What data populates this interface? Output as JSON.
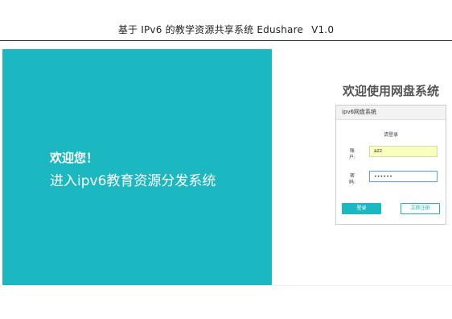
{
  "doc_header": {
    "title": "基于 IPv6 的教学资源共享系统  Edushare",
    "version": "V1.0"
  },
  "left_panel": {
    "welcome": "欢迎您！",
    "subtitle": "进入ipv6教育资源分发系统",
    "color": "#1cb8c1"
  },
  "right_panel": {
    "title": "欢迎使用网盘系统",
    "card": {
      "header": "ipv6网盘系统",
      "prompt": "请登录",
      "username_label_1": "账",
      "username_label_2": "户:",
      "username_value": "azz",
      "password_label_1": "密",
      "password_label_2": "码:",
      "password_value": "••••••",
      "login_button": "登录",
      "register_button": "立即注册"
    }
  }
}
